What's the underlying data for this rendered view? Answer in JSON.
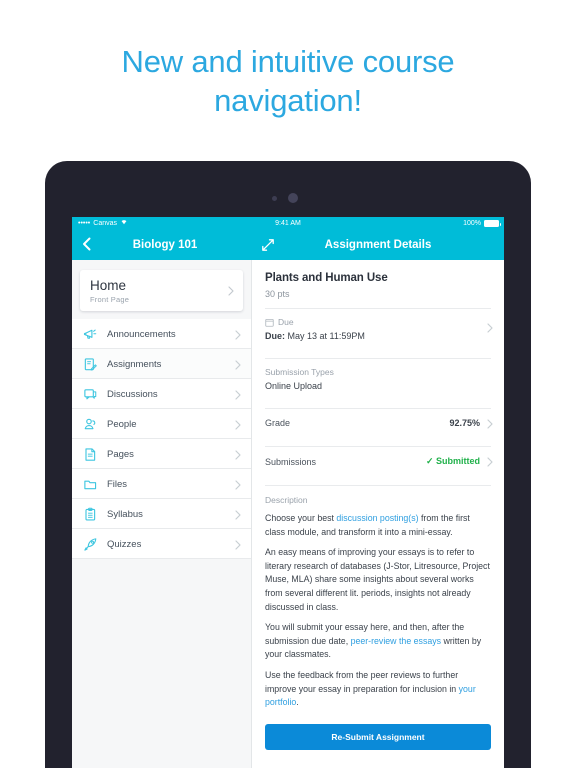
{
  "headline": {
    "line1": "New and intuitive course",
    "line2": "navigation!"
  },
  "colors": {
    "nav_bar": "#00bcd8",
    "headline": "#2ca8e0",
    "device_frame": "#22222e",
    "link": "#2f9fe0",
    "submit_button": "#0b8ad8",
    "submitted_green": "#21b14b"
  },
  "status_bar": {
    "signal_dots": "•••••",
    "carrier": "Canvas",
    "wifi_icon": "wifi-icon",
    "time": "9:41 AM",
    "battery_percent": "100%",
    "battery_icon": "battery-full-icon"
  },
  "nav": {
    "back_icon": "back-chevron-icon",
    "course_title": "Biology 101",
    "expand_icon": "expand-diagonal-icon",
    "detail_title": "Assignment Details"
  },
  "sidebar": {
    "home_card": {
      "title": "Home",
      "subtitle": "Front Page",
      "chevron_icon": "chevron-right-icon"
    },
    "items": [
      {
        "label": "Announcements",
        "icon": "megaphone-icon"
      },
      {
        "label": "Assignments",
        "icon": "document-pencil-icon"
      },
      {
        "label": "Discussions",
        "icon": "speech-bubbles-icon"
      },
      {
        "label": "People",
        "icon": "people-icon"
      },
      {
        "label": "Pages",
        "icon": "page-icon"
      },
      {
        "label": "Files",
        "icon": "folder-icon"
      },
      {
        "label": "Syllabus",
        "icon": "clipboard-icon"
      },
      {
        "label": "Quizzes",
        "icon": "rocket-icon"
      }
    ]
  },
  "detail": {
    "title": "Plants and Human Use",
    "points": "30 pts",
    "due": {
      "label": "Due",
      "icon": "calendar-icon",
      "value_prefix": "Due:",
      "value": "May 13 at 11:59PM"
    },
    "submission_types": {
      "label": "Submission Types",
      "value": "Online Upload"
    },
    "grade": {
      "label": "Grade",
      "value": "92.75%"
    },
    "submissions": {
      "label": "Submissions",
      "value": "✓ Submitted"
    },
    "description": {
      "label": "Description",
      "paragraphs": [
        {
          "segments": [
            {
              "text": "Choose your best ",
              "link": false
            },
            {
              "text": "discussion posting(s)",
              "link": true
            },
            {
              "text": " from the first class module, and transform it into a mini-essay.",
              "link": false
            }
          ]
        },
        {
          "segments": [
            {
              "text": "An easy means of improving your essays is to refer to literary research of databases (J-Stor, Litresource, Project Muse, MLA) share some insights about several works from several different lit. periods, insights not already discussed in class.",
              "link": false
            }
          ]
        },
        {
          "segments": [
            {
              "text": "You will submit your essay here, and then, after the submission due date, ",
              "link": false
            },
            {
              "text": "peer-review the essays",
              "link": true
            },
            {
              "text": " written by your classmates.",
              "link": false
            }
          ]
        },
        {
          "segments": [
            {
              "text": "Use the feedback from the peer reviews to further improve your essay in preparation for inclusion in ",
              "link": false
            },
            {
              "text": "your portfolio",
              "link": true
            },
            {
              "text": ".",
              "link": false
            }
          ]
        }
      ]
    },
    "submit_button": "Re-Submit Assignment"
  }
}
